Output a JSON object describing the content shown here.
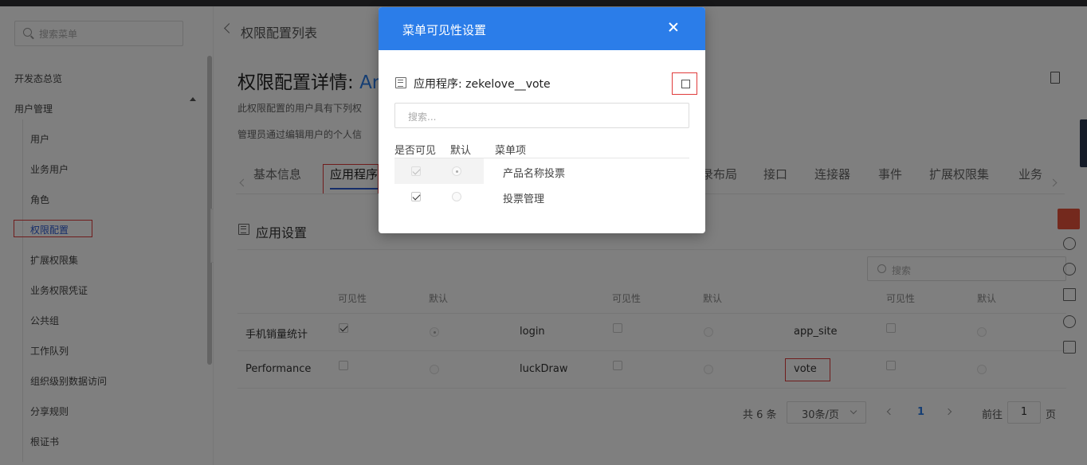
{
  "sidebar": {
    "search_placeholder": "搜索菜单",
    "items": [
      {
        "label": "开发态总览"
      },
      {
        "label": "用户管理"
      },
      {
        "label": "用户"
      },
      {
        "label": "业务用户"
      },
      {
        "label": "角色"
      },
      {
        "label": "权限配置"
      },
      {
        "label": "扩展权限集"
      },
      {
        "label": "业务权限凭证"
      },
      {
        "label": "公共组"
      },
      {
        "label": "工作队列"
      },
      {
        "label": "组织级别数据访问"
      },
      {
        "label": "分享规则"
      },
      {
        "label": "根证书"
      }
    ]
  },
  "header": {
    "back_label": "权限配置列表",
    "title": "权限配置详情: ",
    "title_highlight": "Ar",
    "desc1": "此权限配置的用户具有下列权",
    "desc2": "管理员通过编辑用户的个人信"
  },
  "tabs": [
    "基本信息",
    "应用程序",
    "录布局",
    "接口",
    "连接器",
    "事件",
    "扩展权限集",
    "业务"
  ],
  "section": {
    "title": "应用设置",
    "search_placeholder": "搜索"
  },
  "table": {
    "headers": [
      "可见性",
      "默认",
      "可见性",
      "默认",
      "可见性",
      "默认"
    ],
    "rows": [
      {
        "c1": "手机销量统计",
        "c2": "login",
        "c3": "app_site"
      },
      {
        "c1": "Performance",
        "c2": "luckDraw",
        "c3": "vote"
      }
    ]
  },
  "pagination": {
    "total": "共 6 条",
    "page_size": "30条/页",
    "current": "1",
    "goto_label": "前往",
    "goto_value": "1",
    "page_suffix": "页"
  },
  "modal": {
    "title": "菜单可见性设置",
    "app_label": "应用程序: zekelove__vote",
    "search_placeholder": "搜索...",
    "col_visible": "是否可见",
    "col_default": "默认",
    "col_item": "菜单项",
    "rows": [
      {
        "label": "产品名称投票"
      },
      {
        "label": "投票管理"
      }
    ]
  },
  "colors": {
    "accent": "#2b7de9",
    "highlight_box": "#e03b3b",
    "active_menu": "#2d5bd2"
  }
}
